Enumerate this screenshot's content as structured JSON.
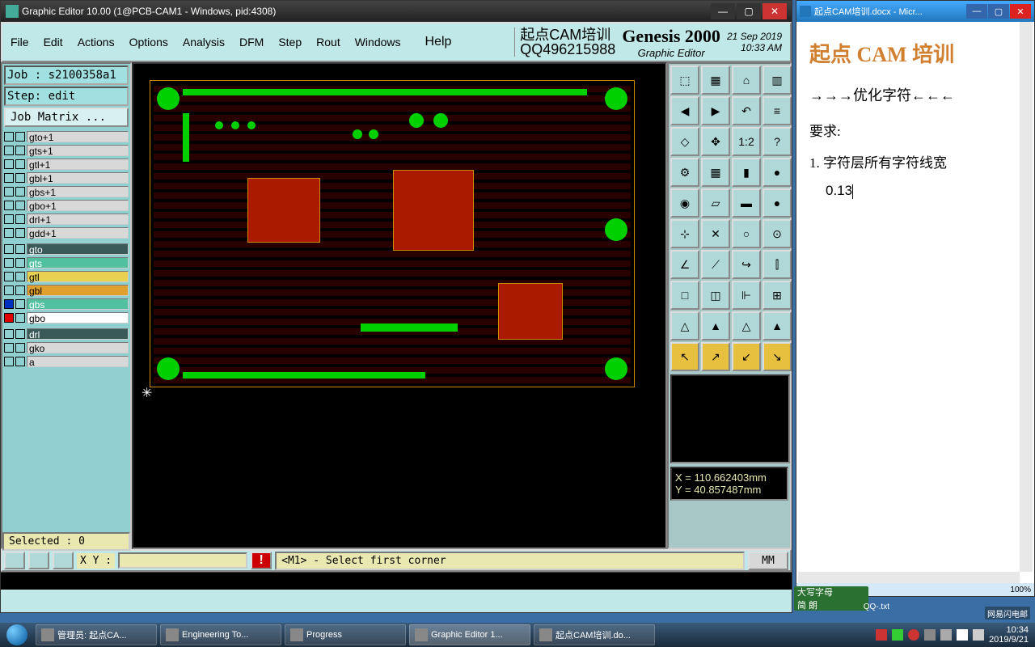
{
  "genesis": {
    "title": "Graphic Editor 10.00 (1@PCB-CAM1 - Windows, pid:4308)",
    "menu": [
      "File",
      "Edit",
      "Actions",
      "Options",
      "Analysis",
      "DFM",
      "Step",
      "Rout",
      "Windows"
    ],
    "help": "Help",
    "banner_cn1": "起点CAM培训",
    "banner_cn2": "QQ496215988",
    "banner_title": "Genesis 2000",
    "banner_sub": "Graphic Editor",
    "date1": "21 Sep 2019",
    "date2": "10:33 AM",
    "job": "Job : s2100358a1",
    "step": "Step: edit",
    "job_matrix": "Job Matrix ...",
    "layers_a": [
      "gto+1",
      "gts+1",
      "gtl+1",
      "gbl+1",
      "gbs+1",
      "gbo+1",
      "drl+1",
      "gdd+1"
    ],
    "layers_b": [
      {
        "name": "gto",
        "class": "dark",
        "cb": ""
      },
      {
        "name": "gts",
        "class": "teal",
        "cb": ""
      },
      {
        "name": "gtl",
        "class": "yellow",
        "cb": ""
      },
      {
        "name": "gbl",
        "class": "orange",
        "cb": ""
      },
      {
        "name": "gbs",
        "class": "teal",
        "cb": "blue"
      },
      {
        "name": "gbo",
        "class": "white",
        "cb": "red"
      }
    ],
    "layers_c": [
      {
        "name": "drl",
        "class": "dark"
      },
      {
        "name": "gko",
        "class": ""
      },
      {
        "name": "a",
        "class": ""
      }
    ],
    "selected": "Selected : 0",
    "coord_x": "X = 110.662403mm",
    "coord_y": "Y = 40.857487mm",
    "xy_label": "X Y :",
    "msg": "<M1> - Select first corner",
    "unit": "MM"
  },
  "word": {
    "title": "起点CAM培训.docx - Micr...",
    "h2": "起点 CAM 培训",
    "arrows": "→→→优化字符←←←",
    "req": "要求:",
    "item1": "1. 字符层所有字符线宽",
    "val": "0.13",
    "zoom": "100%"
  },
  "ime": {
    "line1": "大写字母 ",
    "line2": "简 朗"
  },
  "taskbar": {
    "items": [
      {
        "label": "管理员: 起点CA...",
        "active": false
      },
      {
        "label": "Engineering To...",
        "active": false
      },
      {
        "label": "Progress",
        "active": false
      },
      {
        "label": "Graphic Editor 1...",
        "active": true
      },
      {
        "label": "起点CAM培训.do...",
        "active": false
      }
    ],
    "time": "10:34",
    "date": "2019/9/21"
  },
  "notif": "网易闪电邮",
  "qqtxt": "QQ-.txt"
}
